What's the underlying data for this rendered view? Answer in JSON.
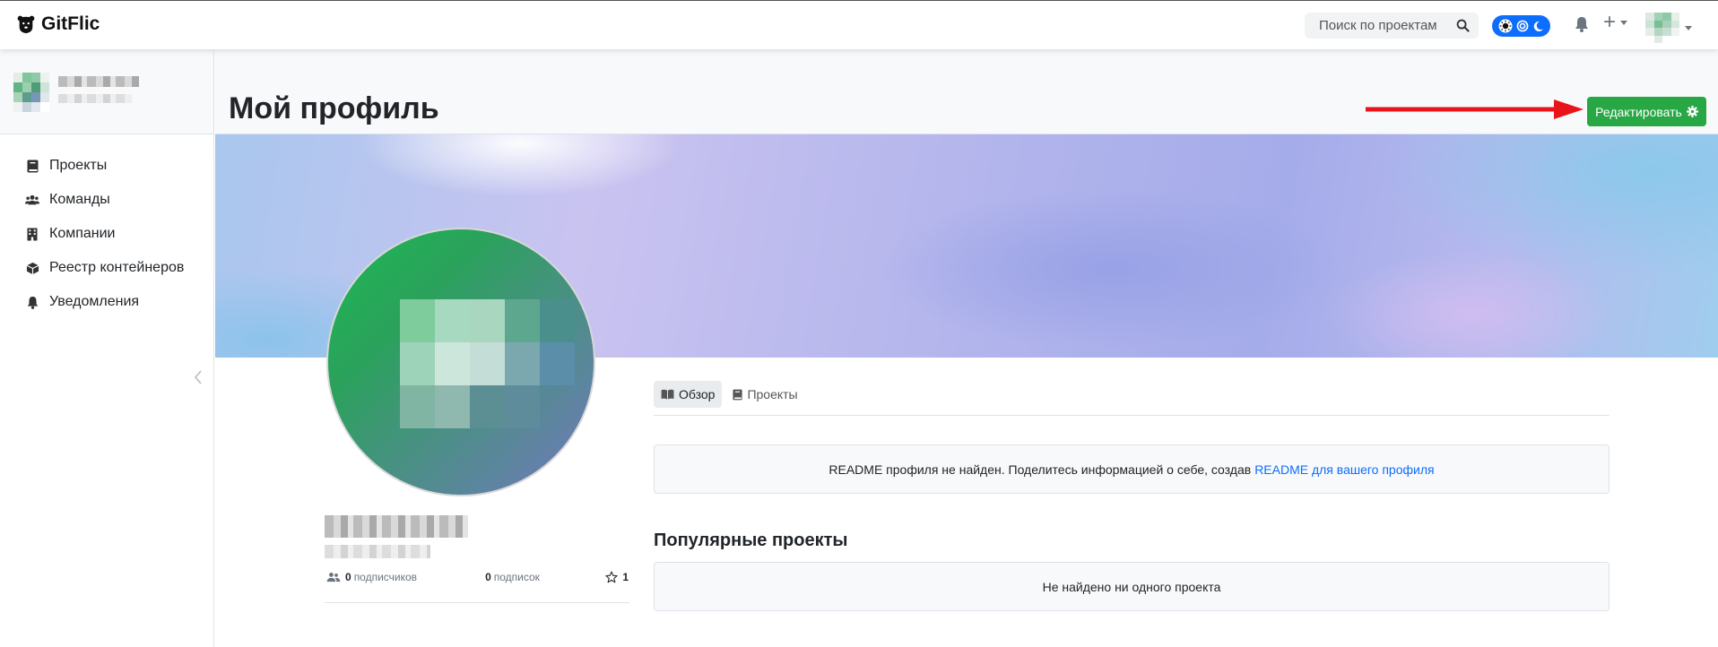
{
  "navbar": {
    "logo_text": "GitFlic",
    "search_placeholder": "Поиск по проектам",
    "icons": [
      "bear-logo-icon",
      "search-icon",
      "sun-icon",
      "circle-dot-icon",
      "moon-icon",
      "bell-icon",
      "plus-icon",
      "chevron-down-icon"
    ]
  },
  "sidebar": {
    "items": [
      {
        "label": "Проекты",
        "icon": "book-icon"
      },
      {
        "label": "Команды",
        "icon": "users-icon"
      },
      {
        "label": "Компании",
        "icon": "building-icon"
      },
      {
        "label": "Реестр контейнеров",
        "icon": "box-icon"
      },
      {
        "label": "Уведомления",
        "icon": "bell-icon"
      }
    ]
  },
  "page": {
    "title": "Мой профиль",
    "edit_button": "Редактировать"
  },
  "profile": {
    "followers_count": "0",
    "followers_label": "подписчиков",
    "following_count": "0",
    "following_label": "подписок",
    "stars_count": "1"
  },
  "tabs": [
    {
      "label": "Обзор",
      "icon": "open-book-icon",
      "active": true
    },
    {
      "label": "Проекты",
      "icon": "book-icon",
      "active": false
    }
  ],
  "readme": {
    "text": "README профиля не найден. Поделитесь информацией о себе, создав",
    "link": "README для вашего профиля"
  },
  "popular": {
    "title": "Популярные проекты",
    "empty_text": "Не найдено ни одного проекта"
  },
  "colors": {
    "accent_green": "#28a745",
    "link_blue": "#0d6efd",
    "annotation_red": "#e8141a",
    "toggle_blue": "#0d6efd"
  }
}
